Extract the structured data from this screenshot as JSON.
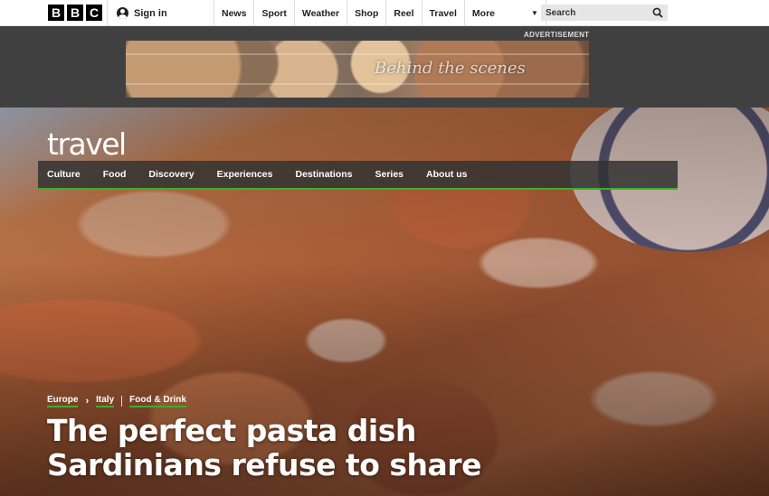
{
  "brand": {
    "logo_letters": [
      "B",
      "B",
      "C"
    ],
    "section_name": "travel"
  },
  "topnav": {
    "signin_label": "Sign in",
    "links": [
      "News",
      "Sport",
      "Weather",
      "Shop",
      "Reel",
      "Travel"
    ],
    "more_label": "More",
    "search_placeholder": "Search"
  },
  "ad": {
    "label": "ADVERTISEMENT",
    "banner_text": "Behind the scenes"
  },
  "subnav": {
    "items": [
      "Culture",
      "Food",
      "Discovery",
      "Experiences",
      "Destinations",
      "Series",
      "About us"
    ]
  },
  "article": {
    "breadcrumbs": [
      "Europe",
      "Italy",
      "Food & Drink"
    ],
    "headline_line1": "The perfect pasta dish",
    "headline_line2": "Sardinians refuse to share"
  },
  "colors": {
    "accent_green": "#3dae2b",
    "ad_band": "#404040"
  },
  "icons": {
    "search": "magnifier",
    "account": "person-silhouette",
    "more_caret": "chevron-down"
  }
}
